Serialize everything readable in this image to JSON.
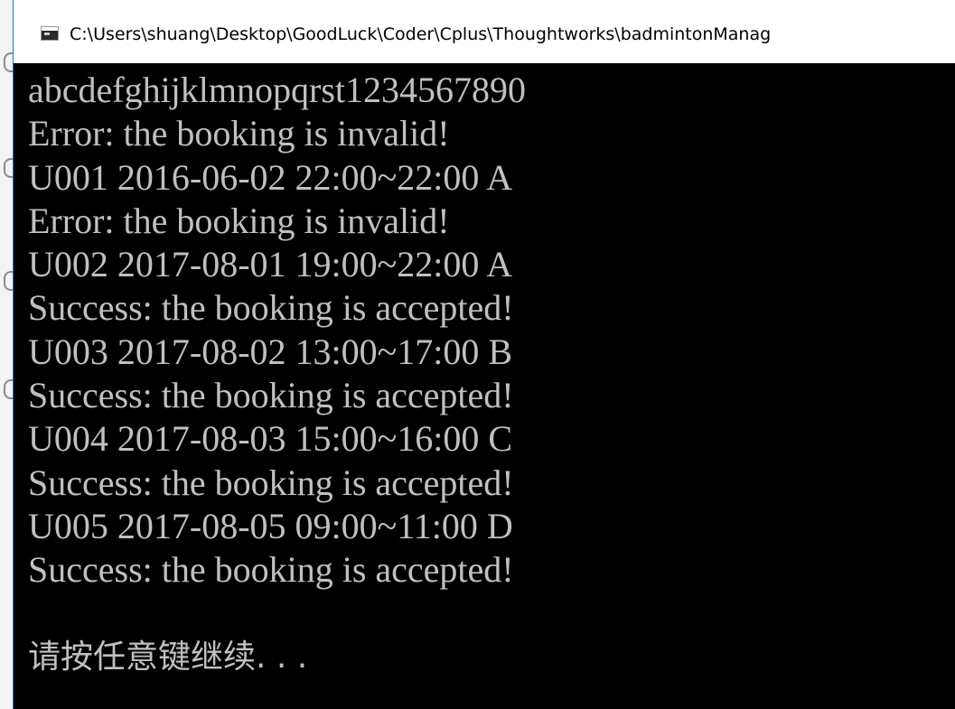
{
  "window": {
    "title": "C:\\Users\\shuang\\Desktop\\GoodLuck\\Coder\\Cplus\\Thoughtworks\\badmintonManag",
    "icon": "console-app-icon"
  },
  "console": {
    "lines": [
      "abcdefghijklmnopqrst1234567890",
      "Error: the booking is invalid!",
      "U001 2016-06-02 22:00~22:00 A",
      "Error: the booking is invalid!",
      "U002 2017-08-01 19:00~22:00 A",
      "Success: the booking is accepted!",
      "U003 2017-08-02 13:00~17:00 B",
      "Success: the booking is accepted!",
      "U004 2017-08-03 15:00~16:00 C",
      "Success: the booking is accepted!",
      "U005 2017-08-05 09:00~11:00 D",
      "Success: the booking is accepted!",
      "",
      "请按任意键继续. . ."
    ],
    "text_color": "#c0c0c0",
    "background_color": "#000000"
  }
}
